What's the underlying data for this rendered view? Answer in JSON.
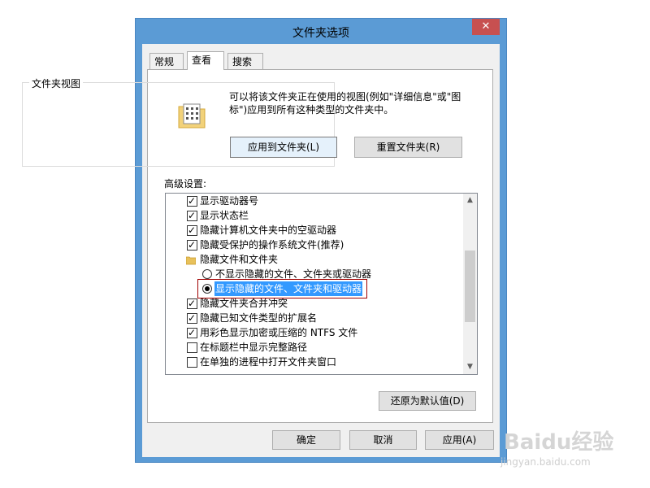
{
  "title": "文件夹选项",
  "close_glyph": "✕",
  "tabs": [
    "常规",
    "查看",
    "搜索"
  ],
  "folder_view": {
    "label": "文件夹视图",
    "desc": "可以将该文件夹正在使用的视图(例如\"详细信息\"或\"图标\")应用到所有这种类型的文件夹中。",
    "apply_button": "应用到文件夹(L)",
    "reset_button": "重置文件夹(R)"
  },
  "advanced": {
    "label": "高级设置:",
    "items": [
      {
        "kind": "checkbox",
        "checked": true,
        "label": "显示驱动器号"
      },
      {
        "kind": "checkbox",
        "checked": true,
        "label": "显示状态栏"
      },
      {
        "kind": "checkbox",
        "checked": true,
        "label": "隐藏计算机文件夹中的空驱动器"
      },
      {
        "kind": "checkbox",
        "checked": true,
        "label": "隐藏受保护的操作系统文件(推荐)"
      },
      {
        "kind": "folder",
        "label": "隐藏文件和文件夹"
      },
      {
        "kind": "radio",
        "checked": false,
        "label": "不显示隐藏的文件、文件夹或驱动器"
      },
      {
        "kind": "radio",
        "checked": true,
        "label": "显示隐藏的文件、文件夹和驱动器"
      },
      {
        "kind": "checkbox",
        "checked": true,
        "label": "隐藏文件夹合并冲突"
      },
      {
        "kind": "checkbox",
        "checked": true,
        "label": "隐藏已知文件类型的扩展名"
      },
      {
        "kind": "checkbox",
        "checked": true,
        "label": "用彩色显示加密或压缩的 NTFS 文件"
      },
      {
        "kind": "checkbox",
        "checked": false,
        "label": "在标题栏中显示完整路径"
      },
      {
        "kind": "checkbox",
        "checked": false,
        "label": "在单独的进程中打开文件夹窗口"
      }
    ],
    "restore_button": "还原为默认值(D)"
  },
  "footer": {
    "ok": "确定",
    "cancel": "取消",
    "apply": "应用(A)"
  },
  "watermark": {
    "brand": "Baidu经验",
    "url": "jingyan.baidu.com"
  }
}
